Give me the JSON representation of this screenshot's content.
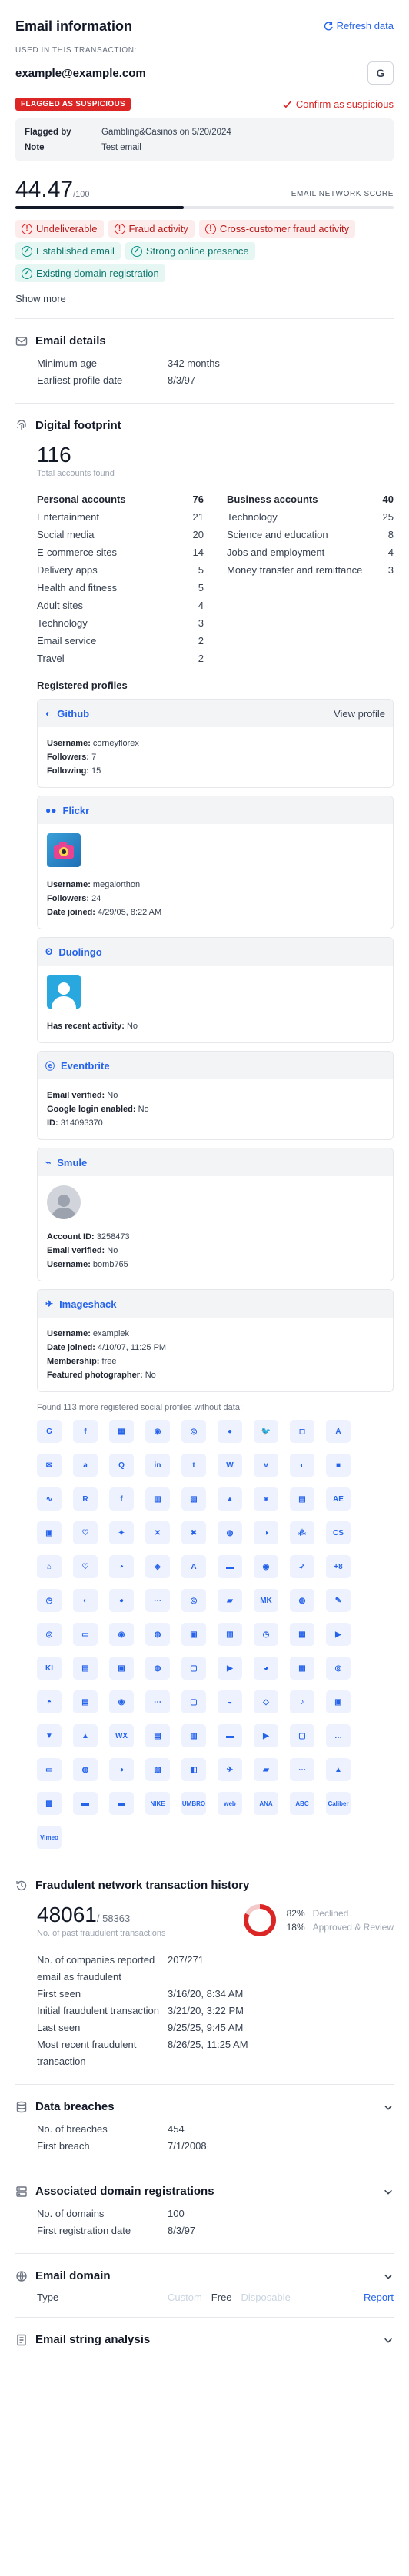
{
  "header": {
    "title": "Email information",
    "refresh_label": "Refresh data"
  },
  "transaction": {
    "label": "USED IN THIS TRANSACTION:",
    "email": "example@example.com",
    "g_button": "G"
  },
  "flag": {
    "badge": "FLAGGED AS SUSPICIOUS",
    "confirm_label": "Confirm as suspicious",
    "flagged_by_key": "Flagged by",
    "flagged_by_value": "Gambling&Casinos on 5/20/2024",
    "note_key": "Note",
    "note_value": "Test email"
  },
  "score": {
    "value": "44.47",
    "max": "/100",
    "label": "EMAIL NETWORK SCORE",
    "fraction": 0.4447
  },
  "tags": [
    {
      "label": "Undeliverable",
      "kind": "red"
    },
    {
      "label": "Fraud activity",
      "kind": "red"
    },
    {
      "label": "Cross-customer fraud activity",
      "kind": "red"
    },
    {
      "label": "Established email",
      "kind": "teal"
    },
    {
      "label": "Strong online presence",
      "kind": "teal"
    },
    {
      "label": "Existing domain registration",
      "kind": "teal"
    }
  ],
  "show_more": "Show more",
  "email_details": {
    "title": "Email details",
    "rows": [
      {
        "k": "Minimum age",
        "v": "342 months"
      },
      {
        "k": "Earliest profile date",
        "v": "8/3/97"
      }
    ]
  },
  "digital_footprint": {
    "title": "Digital footprint",
    "total": "116",
    "total_label": "Total accounts found",
    "left": [
      {
        "k": "Personal accounts",
        "v": "76",
        "head": true
      },
      {
        "k": "Entertainment",
        "v": "21"
      },
      {
        "k": "Social media",
        "v": "20"
      },
      {
        "k": "E-commerce sites",
        "v": "14"
      },
      {
        "k": "Delivery apps",
        "v": "5"
      },
      {
        "k": "Health and fitness",
        "v": "5"
      },
      {
        "k": "Adult sites",
        "v": "4"
      },
      {
        "k": "Technology",
        "v": "3"
      },
      {
        "k": "Email service",
        "v": "2"
      },
      {
        "k": "Travel",
        "v": "2"
      }
    ],
    "right": [
      {
        "k": "Business accounts",
        "v": "40",
        "head": true
      },
      {
        "k": "Technology",
        "v": "25"
      },
      {
        "k": "Science and education",
        "v": "8"
      },
      {
        "k": "Jobs and employment",
        "v": "4"
      },
      {
        "k": "Money transfer and remittance",
        "v": "3"
      }
    ],
    "registered_title": "Registered profiles",
    "profiles": [
      {
        "name": "Github",
        "view": "View profile",
        "lines": [
          [
            "Username:",
            "corneyflorex"
          ],
          [
            "Followers:",
            "7"
          ],
          [
            "Following:",
            "15"
          ]
        ]
      },
      {
        "name": "Flickr",
        "lines": [
          [
            "Username:",
            "megalorthon"
          ],
          [
            "Followers:",
            "24"
          ],
          [
            "Date joined:",
            "4/29/05, 8:22 AM"
          ]
        ]
      },
      {
        "name": "Duolingo",
        "lines": [
          [
            "Has recent activity:",
            "No"
          ]
        ]
      },
      {
        "name": "Eventbrite",
        "lines": [
          [
            "Email verified:",
            "No"
          ],
          [
            "Google login enabled:",
            "No"
          ],
          [
            "ID:",
            "314093370"
          ]
        ]
      },
      {
        "name": "Smule",
        "lines": [
          [
            "Account ID:",
            "3258473"
          ],
          [
            "Email verified:",
            "No"
          ],
          [
            "Username:",
            "bomb765"
          ]
        ]
      },
      {
        "name": "Imageshack",
        "lines": [
          [
            "Username:",
            "examplek"
          ],
          [
            "Date joined:",
            "4/10/07, 11:25 PM"
          ],
          [
            "Membership:",
            "free"
          ],
          [
            "Featured photographer:",
            "No"
          ]
        ]
      }
    ],
    "found_note": "Found 113 more registered social profiles without data:",
    "icons": [
      "G",
      "f",
      "▦",
      "◉",
      "◎",
      "●",
      "🐦",
      "◻",
      "A",
      "✉",
      "a",
      "Q",
      "in",
      "t",
      "W",
      "v",
      "◐",
      "■",
      "∿",
      "R",
      "f",
      "▥",
      "▧",
      "▲",
      "◙",
      "▤",
      "AE",
      "▣",
      "♡",
      "✦",
      "✕",
      "✖",
      "◍",
      "◑",
      "⁂",
      "CS",
      "⌂",
      "♡",
      "◔",
      "◈",
      "A",
      "▬",
      "◉",
      "➶",
      "+8",
      "◷",
      "◐",
      "◕",
      "⋯",
      "◎",
      "▰",
      "MK",
      "◍",
      "✎",
      "◎",
      "▭",
      "◉",
      "◍",
      "▣",
      "▥",
      "◷",
      "▦",
      "▶",
      "KI",
      "▤",
      "▣",
      "◍",
      "▢",
      "▶",
      "◕",
      "▦",
      "◎",
      "◓",
      "▤",
      "◉",
      "⋯",
      "▢",
      "◒",
      "◇",
      "♪",
      "▣",
      "▼",
      "▲",
      "WX",
      "▤",
      "▥",
      "▬",
      "▶",
      "▢",
      "…",
      "▭",
      "◍",
      "◑",
      "▧",
      "◧",
      "✈",
      "▰",
      "⋯",
      "▲",
      "▩",
      "▬",
      "▬"
    ],
    "icon_text_labels": [
      "NIKE",
      "UMBRO",
      "web",
      "ANA",
      "ABC",
      "Caliber",
      "Vimeo"
    ]
  },
  "fraud_history": {
    "title": "Fraudulent network transaction history",
    "count": "48061",
    "total": "/ 58363",
    "sub": "No. of past fraudulent transactions",
    "declined_pct": "82%",
    "declined_label": "Declined",
    "approved_pct": "18%",
    "approved_label": "Approved & Review",
    "declined_fraction": 0.82,
    "rows": [
      {
        "k": "No. of companies reported email as fraudulent",
        "v": "207/271"
      },
      {
        "k": "First seen",
        "v": "3/16/20, 8:34 AM"
      },
      {
        "k": "Initial fraudulent transaction",
        "v": "3/21/20, 3:22 PM"
      },
      {
        "k": "Last seen",
        "v": "9/25/25, 9:45 AM"
      },
      {
        "k": "Most recent fraudulent transaction",
        "v": "8/26/25, 11:25 AM"
      }
    ]
  },
  "breaches": {
    "title": "Data breaches",
    "rows": [
      {
        "k": "No. of breaches",
        "v": "454"
      },
      {
        "k": "First breach",
        "v": "7/1/2008"
      }
    ]
  },
  "domains": {
    "title": "Associated domain registrations",
    "rows": [
      {
        "k": "No. of domains",
        "v": "100"
      },
      {
        "k": "First registration date",
        "v": "8/3/97"
      }
    ]
  },
  "email_domain": {
    "title": "Email domain",
    "type_key": "Type",
    "options": [
      "Custom",
      "Free",
      "Disposable"
    ],
    "selected": "Free",
    "report": "Report"
  },
  "email_string": {
    "title": "Email string analysis"
  }
}
